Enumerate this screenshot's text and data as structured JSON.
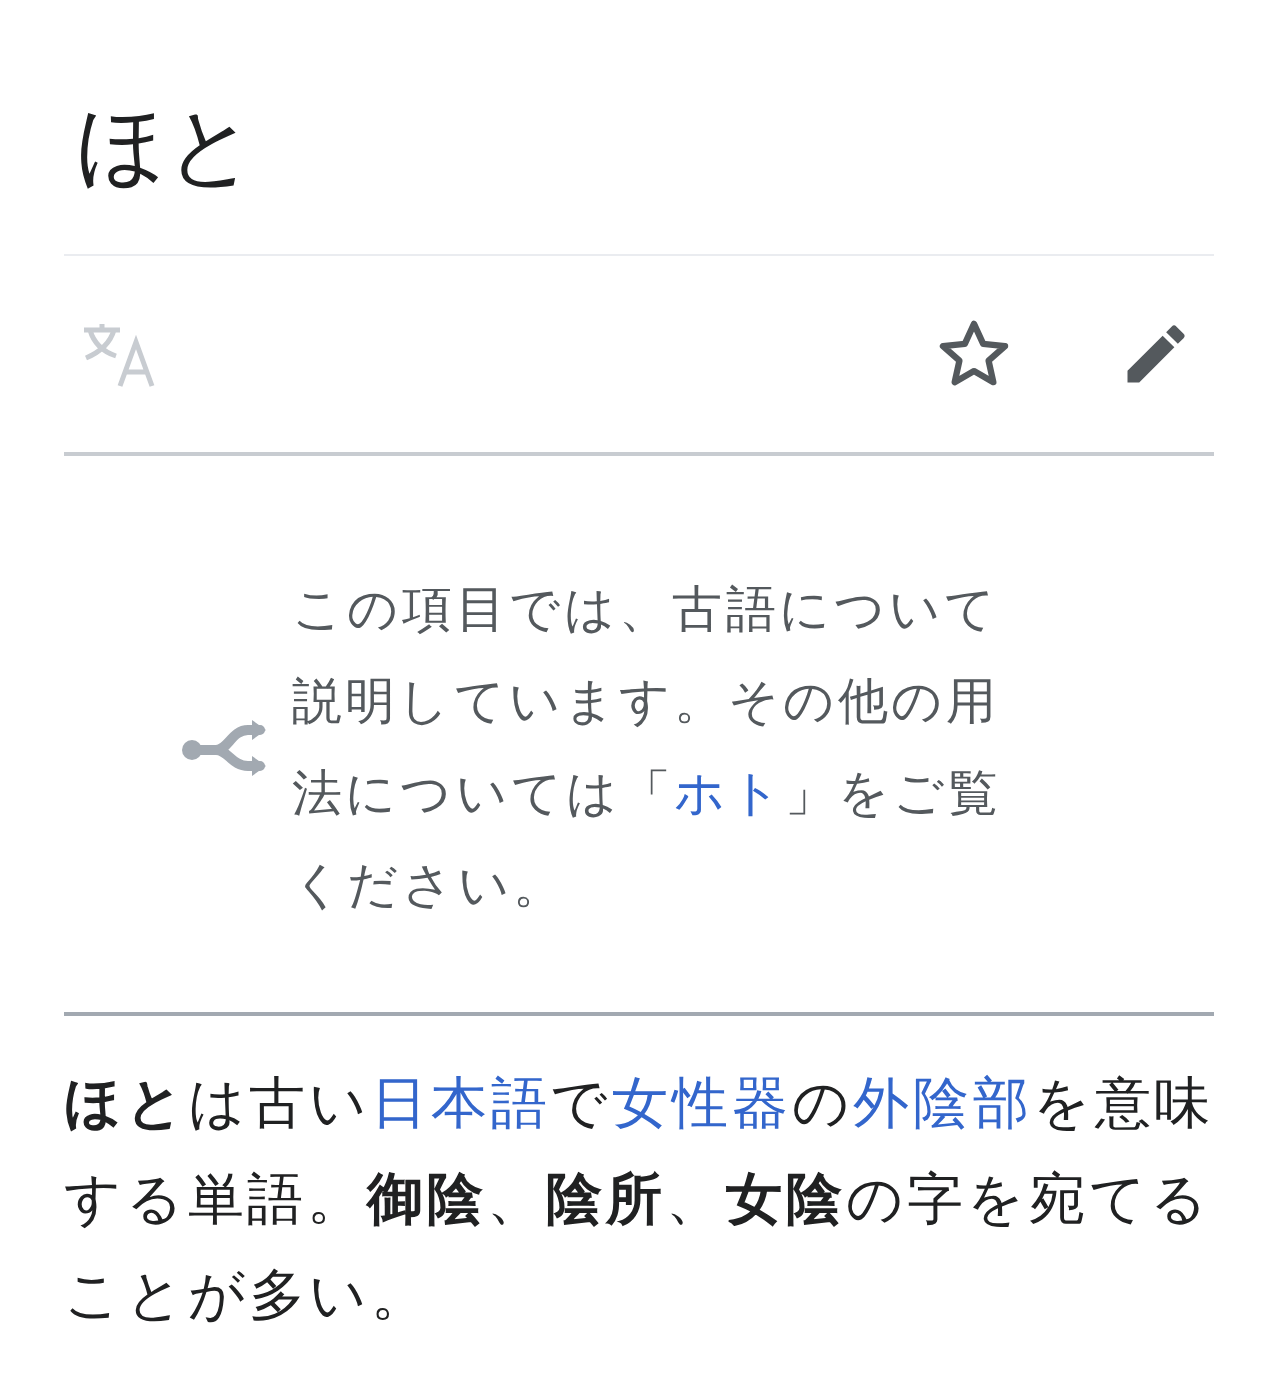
{
  "title": "ほと",
  "hatnote": [
    {
      "kind": "text",
      "text": "この項目では、古語について説明しています。その他の用法については「"
    },
    {
      "kind": "link",
      "text": "ホト"
    },
    {
      "kind": "text",
      "text": "」をご覧ください。"
    }
  ],
  "paragraph": [
    {
      "kind": "bold",
      "text": "ほと"
    },
    {
      "kind": "text",
      "text": "は古い"
    },
    {
      "kind": "link",
      "text": "日本語"
    },
    {
      "kind": "text",
      "text": "で"
    },
    {
      "kind": "link",
      "text": "女性器"
    },
    {
      "kind": "text",
      "text": "の"
    },
    {
      "kind": "link",
      "text": "外陰部"
    },
    {
      "kind": "text",
      "text": "を意味する単語。"
    },
    {
      "kind": "bold",
      "text": "御陰"
    },
    {
      "kind": "text",
      "text": "、"
    },
    {
      "kind": "bold",
      "text": "陰所"
    },
    {
      "kind": "text",
      "text": "、"
    },
    {
      "kind": "bold",
      "text": "女陰"
    },
    {
      "kind": "text",
      "text": "の字を宛てることが多い。"
    }
  ]
}
